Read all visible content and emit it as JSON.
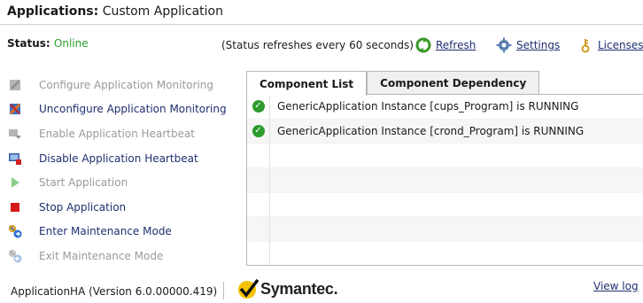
{
  "header": {
    "title_bold": "Applications:",
    "title_rest": "Custom Application"
  },
  "status": {
    "label": "Status:",
    "value": "Online",
    "refresh_note": "(Status refreshes every 60 seconds)",
    "refresh_label": "Refresh",
    "settings_label": "Settings",
    "licenses_label": "Licenses"
  },
  "actions": [
    {
      "label": "Configure Application Monitoring",
      "enabled": false,
      "icon": "configure-icon"
    },
    {
      "label": "Unconfigure Application Monitoring",
      "enabled": true,
      "icon": "unconfigure-icon"
    },
    {
      "label": "Enable Application Heartbeat",
      "enabled": false,
      "icon": "enable-heartbeat-icon"
    },
    {
      "label": "Disable Application Heartbeat",
      "enabled": true,
      "icon": "disable-heartbeat-icon"
    },
    {
      "label": "Start Application",
      "enabled": false,
      "icon": "start-icon"
    },
    {
      "label": "Stop Application",
      "enabled": true,
      "icon": "stop-icon"
    },
    {
      "label": "Enter Maintenance Mode",
      "enabled": true,
      "icon": "enter-maintenance-icon"
    },
    {
      "label": "Exit Maintenance Mode",
      "enabled": false,
      "icon": "exit-maintenance-icon"
    }
  ],
  "tabs": [
    {
      "label": "Component List",
      "active": true
    },
    {
      "label": "Component Dependency",
      "active": false
    }
  ],
  "components": [
    {
      "text": "GenericApplication Instance [cups_Program] is RUNNING",
      "state": "running"
    },
    {
      "text": "GenericApplication Instance [crond_Program] is RUNNING",
      "state": "running"
    },
    {
      "text": "",
      "state": ""
    },
    {
      "text": "",
      "state": ""
    },
    {
      "text": "",
      "state": ""
    },
    {
      "text": "",
      "state": ""
    },
    {
      "text": "",
      "state": ""
    }
  ],
  "footer": {
    "version": "ApplicationHA (Version 6.0.00000.419)",
    "brand": "Symantec.",
    "view_log": "View log"
  },
  "colors": {
    "online": "#2aa02a",
    "link": "#1f2f6f",
    "disabled": "#9a9a9a",
    "running": "#2d9b2d"
  }
}
